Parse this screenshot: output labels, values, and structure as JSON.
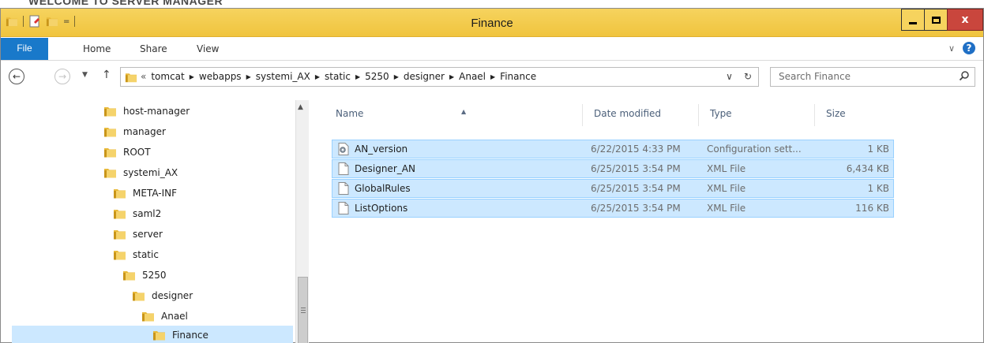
{
  "background_text": "WELCOME TO SERVER MANAGER",
  "window": {
    "title": "Finance",
    "quick_access_dropdown": "=",
    "controls": {
      "minimize": "minimize",
      "maximize": "maximize",
      "close": "x"
    }
  },
  "ribbon": {
    "tabs": [
      "File",
      "Home",
      "Share",
      "View"
    ],
    "expand_chevron": "∨",
    "help_label": "?"
  },
  "navigation": {
    "back": "←",
    "forward": "→",
    "up": "↑",
    "recent_dropdown": "▼"
  },
  "address": {
    "overflow": "«",
    "crumbs": [
      "tomcat",
      "webapps",
      "systemi_AX",
      "static",
      "5250",
      "designer",
      "Anael",
      "Finance"
    ],
    "dropdown": "∨",
    "refresh": "↻"
  },
  "search": {
    "placeholder": "Search Finance"
  },
  "tree": {
    "items": [
      {
        "label": "host-manager"
      },
      {
        "label": "manager"
      },
      {
        "label": "ROOT"
      },
      {
        "label": "systemi_AX"
      },
      {
        "label": "META-INF"
      },
      {
        "label": "saml2"
      },
      {
        "label": "server"
      },
      {
        "label": "static"
      },
      {
        "label": "5250"
      },
      {
        "label": "designer"
      },
      {
        "label": "Anael"
      },
      {
        "label": "Finance",
        "selected": true
      }
    ]
  },
  "file_list": {
    "columns": [
      "Name",
      "Date modified",
      "Type",
      "Size"
    ],
    "sort_indicator": "▲",
    "rows": [
      {
        "name": "AN_version",
        "date": "6/22/2015 4:33 PM",
        "type": "Configuration sett...",
        "size": "1 KB",
        "icon": "config-file-icon"
      },
      {
        "name": "Designer_AN",
        "date": "6/25/2015 3:54 PM",
        "type": "XML File",
        "size": "6,434 KB",
        "icon": "xml-file-icon"
      },
      {
        "name": "GlobalRules",
        "date": "6/25/2015 3:54 PM",
        "type": "XML File",
        "size": "1 KB",
        "icon": "xml-file-icon"
      },
      {
        "name": "ListOptions",
        "date": "6/25/2015 3:54 PM",
        "type": "XML File",
        "size": "116 KB",
        "icon": "xml-file-icon"
      }
    ]
  },
  "colors": {
    "title_bar": "#f0c43e",
    "file_tab": "#1979ca",
    "selection": "#cce8ff",
    "selection_border": "#99d1ff",
    "close_button": "#c9463d",
    "folder": "#e8b93a"
  }
}
